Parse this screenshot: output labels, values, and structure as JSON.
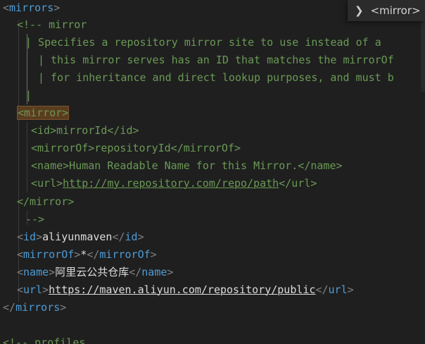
{
  "editor": {
    "lines": [
      {
        "id": "l1",
        "parts": [
          [
            "bracket",
            "<"
          ],
          [
            "tag",
            "mirrors"
          ],
          [
            "bracket",
            ">"
          ]
        ]
      },
      {
        "id": "l2",
        "parts": [
          [
            "comment",
            "<!-- mirror"
          ]
        ]
      },
      {
        "id": "l3",
        "parts": [
          [
            "comment",
            "| Specifies a repository mirror site to use instead of a"
          ]
        ]
      },
      {
        "id": "l4",
        "parts": [
          [
            "comment",
            "| this mirror serves has an ID that matches the mirrorOf"
          ]
        ]
      },
      {
        "id": "l5",
        "parts": [
          [
            "comment",
            "| for inheritance and direct lookup purposes, and must b"
          ]
        ]
      },
      {
        "id": "l6",
        "parts": [
          [
            "comment",
            "|"
          ]
        ]
      },
      {
        "id": "l7",
        "parts": [
          [
            "comment",
            "<mirror>"
          ]
        ]
      },
      {
        "id": "l8",
        "parts": [
          [
            "comment",
            "<id>mirrorId</id>"
          ]
        ]
      },
      {
        "id": "l9",
        "parts": [
          [
            "comment",
            "<mirrorOf>repositoryId</mirrorOf>"
          ]
        ]
      },
      {
        "id": "l10",
        "parts": [
          [
            "comment",
            "<name>Human Readable Name for this Mirror.</name>"
          ]
        ]
      },
      {
        "id": "l11",
        "parts": [
          [
            "comment",
            "<url>"
          ],
          [
            "comment-url",
            "http://my.repository.com/repo/path"
          ],
          [
            "comment",
            "</url>"
          ]
        ]
      },
      {
        "id": "l12",
        "parts": [
          [
            "comment",
            "</mirror>"
          ]
        ]
      },
      {
        "id": "l13",
        "parts": [
          [
            "comment",
            "-->"
          ]
        ]
      },
      {
        "id": "l14",
        "parts": [
          [
            "bracket",
            "<"
          ],
          [
            "tag",
            "id"
          ],
          [
            "bracket",
            ">"
          ],
          [
            "text",
            "aliyunmaven"
          ],
          [
            "bracket",
            "</"
          ],
          [
            "tag",
            "id"
          ],
          [
            "bracket",
            ">"
          ]
        ]
      },
      {
        "id": "l15",
        "parts": [
          [
            "bracket",
            "<"
          ],
          [
            "tag",
            "mirrorOf"
          ],
          [
            "bracket",
            ">"
          ],
          [
            "text",
            "*"
          ],
          [
            "bracket",
            "</"
          ],
          [
            "tag",
            "mirrorOf"
          ],
          [
            "bracket",
            ">"
          ]
        ]
      },
      {
        "id": "l16",
        "parts": [
          [
            "bracket",
            "<"
          ],
          [
            "tag",
            "name"
          ],
          [
            "bracket",
            ">"
          ],
          [
            "text",
            "阿里云公共仓库"
          ],
          [
            "bracket",
            "</"
          ],
          [
            "tag",
            "name"
          ],
          [
            "bracket",
            ">"
          ]
        ]
      },
      {
        "id": "l17",
        "parts": [
          [
            "bracket",
            "<"
          ],
          [
            "tag",
            "url"
          ],
          [
            "bracket",
            ">"
          ],
          [
            "text-url",
            "https://maven.aliyun.com/repository/public"
          ],
          [
            "bracket",
            "</"
          ],
          [
            "tag",
            "url"
          ],
          [
            "bracket",
            ">"
          ]
        ]
      },
      {
        "id": "l18",
        "parts": [
          [
            "bracket",
            "</"
          ],
          [
            "tag",
            "mirrors"
          ],
          [
            "bracket",
            ">"
          ]
        ]
      },
      {
        "id": "l19",
        "parts": [
          [
            "comment",
            "<!-- profiles"
          ]
        ]
      }
    ]
  },
  "breadcrumb": {
    "chevron": "❯",
    "label": "<mirror>"
  },
  "colors": {
    "background": "#1f1f1f",
    "tag": "#4e9cd6",
    "bracket": "#808080",
    "text": "#dcdcdc",
    "comment": "#6a9955",
    "highlight": "#5a3c1e"
  }
}
